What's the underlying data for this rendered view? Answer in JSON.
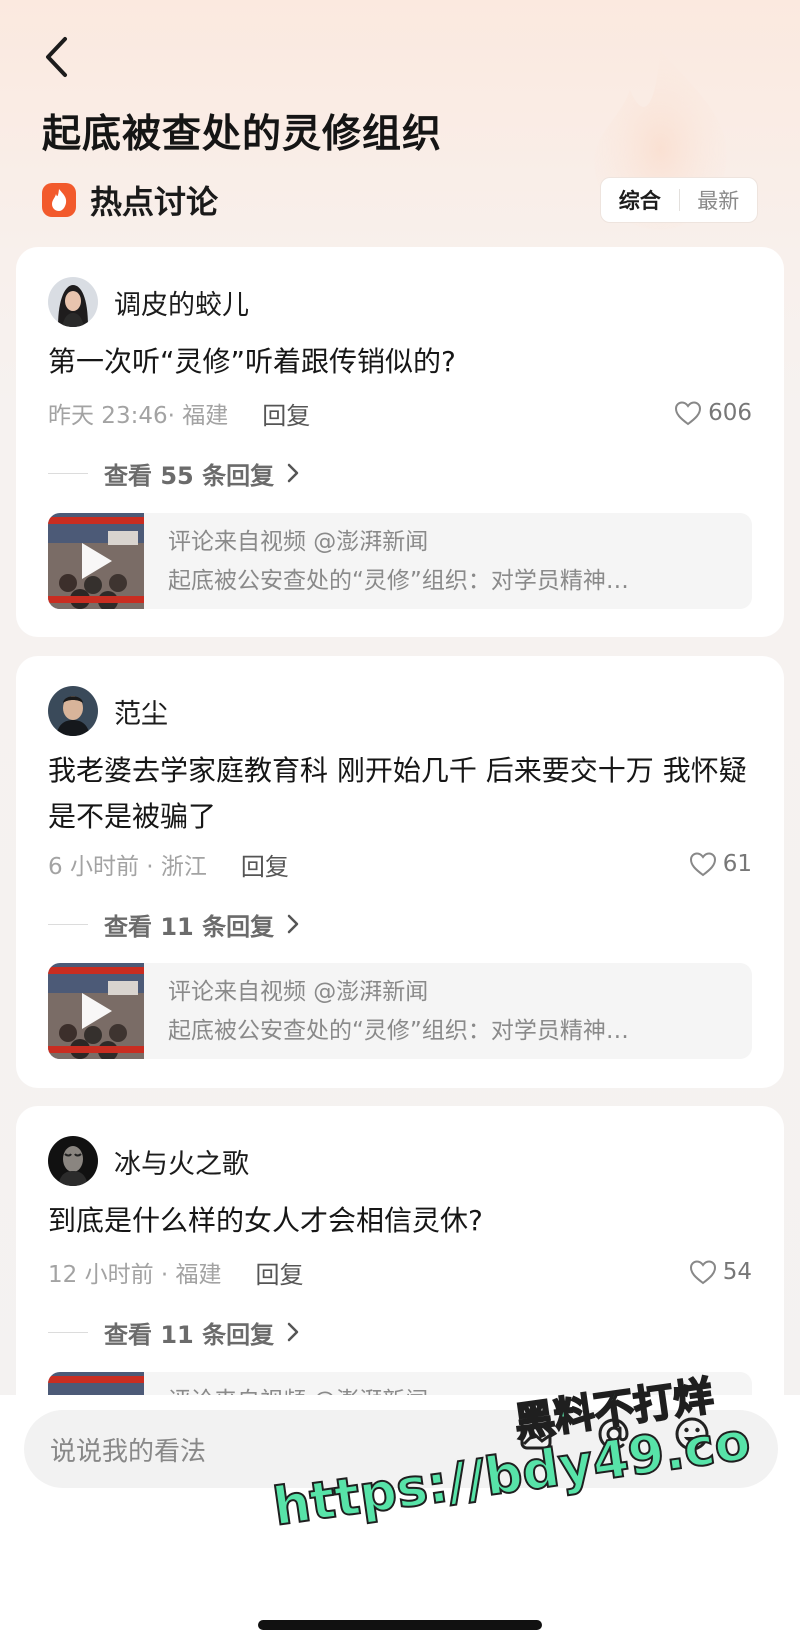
{
  "header": {
    "title": "起底被查处的灵修组织",
    "hot_label": "热点讨论",
    "sort_options": [
      "综合",
      "最新"
    ]
  },
  "comments": [
    {
      "username": "调皮的蛟儿",
      "text": "第一次听“灵修”听着跟传销似的?",
      "meta": "昨天 23:46· 福建",
      "reply_label": "回复",
      "likes": "606",
      "replies_label": "查看 55 条回复",
      "source_from": "评论来自视频 @澎湃新闻",
      "source_title": "起底被公安查处的“灵修”组织：对学员精神…"
    },
    {
      "username": "范尘",
      "text": "我老婆去学家庭教育科 刚开始几千 后来要交十万 我怀疑是不是被骗了",
      "meta": "6 小时前 · 浙江",
      "reply_label": "回复",
      "likes": "61",
      "replies_label": "查看 11 条回复",
      "source_from": "评论来自视频 @澎湃新闻",
      "source_title": "起底被公安查处的“灵修”组织：对学员精神…"
    },
    {
      "username": "冰与火之歌",
      "text": "到底是什么样的女人才会相信灵休?",
      "meta": "12 小时前 · 福建",
      "reply_label": "回复",
      "likes": "54",
      "replies_label": "查看 11 条回复",
      "source_from": "评论来自视频 @澎湃新闻"
    }
  ],
  "input": {
    "placeholder": "说说我的看法"
  },
  "watermark": {
    "line1": "黑料不打烊",
    "line2": "https://bdy49.co"
  },
  "colors": {
    "accent": "#f25a2c",
    "card_bg": "#ffffff",
    "watermark": "#57e3a8"
  }
}
